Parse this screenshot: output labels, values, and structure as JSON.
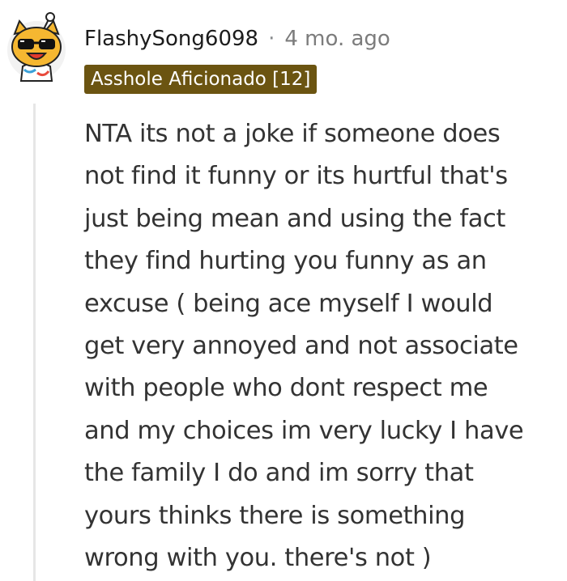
{
  "comment": {
    "username": "FlashySong6098",
    "separator": "·",
    "timestamp": "4 mo. ago",
    "flair": "Asshole Aficionado [12]",
    "flair_color": "#6b5411",
    "thread_line_color": "#e6e6e6",
    "avatar_icon": "snoo-avatar-yellow-dog-sunglasses",
    "body_lines": [
      "NTA its not a joke if someone does",
      "not find it funny or its hurtful that's",
      "just being mean and using the fact",
      "they find hurting you funny as an",
      "excuse ( being ace myself I would",
      "get very annoyed and not associate",
      "with people who dont respect me",
      "and my choices im very lucky I have",
      "the family I do and im sorry that",
      "yours thinks there is something",
      "wrong with you. there's not )"
    ]
  }
}
